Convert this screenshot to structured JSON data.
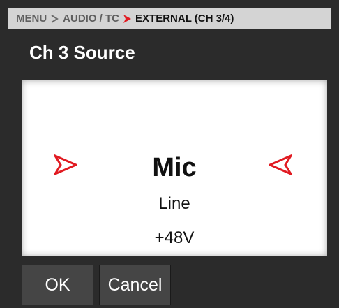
{
  "breadcrumb": {
    "items": [
      "MENU",
      "AUDIO / TC"
    ],
    "current": "EXTERNAL (CH 3/4)"
  },
  "title": "Ch 3 Source",
  "selector": {
    "options": [
      "Mic",
      "Line",
      "+48V"
    ],
    "selected": "Mic"
  },
  "buttons": {
    "ok": "OK",
    "cancel": "Cancel"
  },
  "colors": {
    "background": "#2b2b2b",
    "breadcrumb_bg": "#d4d4d4",
    "accent_red": "#e11b22",
    "button_bg": "#454545"
  },
  "icons": {
    "breadcrumb_separator": "chevron-right-icon",
    "breadcrumb_current_separator": "red-arrow-right-icon",
    "prev_arrow": "red-arrow-right-icon",
    "next_arrow": "red-arrow-left-icon"
  }
}
